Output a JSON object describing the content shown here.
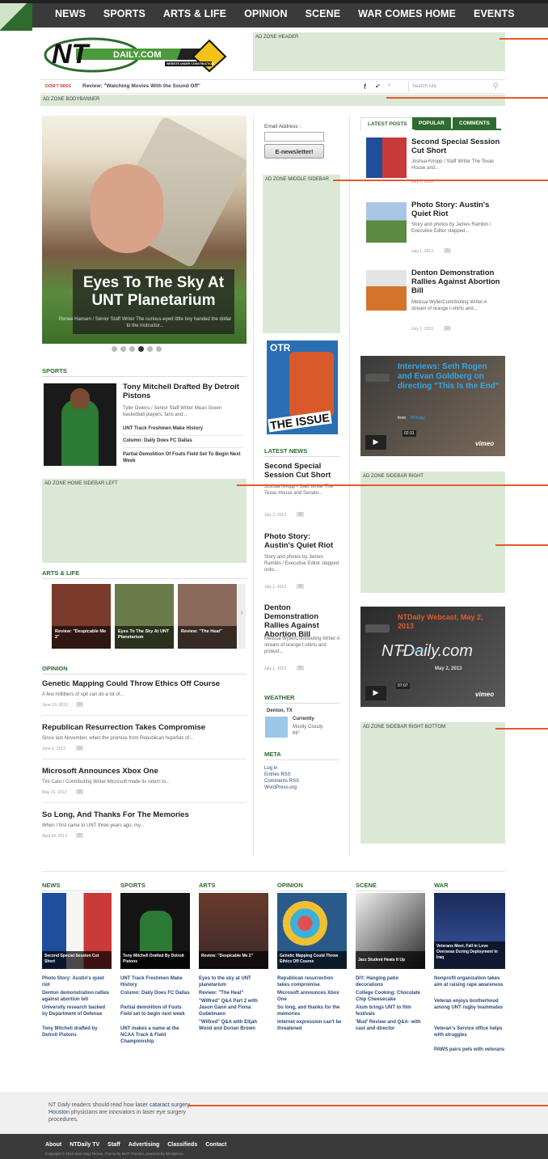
{
  "nav": {
    "items": [
      "NEWS",
      "SPORTS",
      "ARTS & LIFE",
      "OPINION",
      "SCENE",
      "WAR COMES HOME",
      "EVENTS"
    ]
  },
  "logo": {
    "text": "NT",
    "domain": "DAILY.COM",
    "tagline": "WEBSITE UNDER CONSTRUCTION"
  },
  "ads": {
    "header": "AD ZONE HEADER",
    "bodybanner": "AD ZONE BODYBANNER",
    "middle": "AD ZONE MIDDLE SIDEBAR",
    "home_left": "AD ZONE HOME SIDEBAR LEFT",
    "right": "AD ZONE SIDEBAR RIGHT",
    "right_bottom": "AD ZONE SIDEBAR RIGHT BOTTOM"
  },
  "ticker": {
    "label": "DON'T MISS",
    "text": "Review: \"Watching Movies With the Sound Off\"",
    "search_placeholder": "Search site"
  },
  "hero": {
    "title": "Eyes To The Sky At UNT Planetarium",
    "caption": "Renee Hansen / Senior Staff Writer The curious-eyed little boy handed the dollar to the instructor..."
  },
  "sports": {
    "heading": "SPORTS",
    "title": "Tony Mitchell Drafted By Detroit Pistons",
    "excerpt": "Tyler Owens / Senior Staff Writer Mean Green basketball players, fans and...",
    "links": [
      "UNT Track Freshmen Make History",
      "Column: Daily Does FC Dallas",
      "Partial Demolition Of Fouts Field Set To Begin Next Week"
    ]
  },
  "arts": {
    "heading": "ARTS & LIFE",
    "items": [
      "Review: \"Despicable Me 2\"",
      "Eyes To The Sky At UNT Planetarium",
      "Review: \"The Heat\""
    ]
  },
  "opinion": {
    "heading": "OPINION",
    "items": [
      {
        "title": "Genetic Mapping Could Throw Ethics Off Course",
        "excerpt": "A few milliliters of spit can do a lot of...",
        "date": "June 19, 2013",
        "count": "0"
      },
      {
        "title": "Republican Resurrection Takes Compromise",
        "excerpt": "Since last November, when the promise from Republican hopefuls of...",
        "date": "June 6, 2013",
        "count": "0"
      },
      {
        "title": "Microsoft Announces Xbox One",
        "excerpt": "Tim Cato / Contributing Writer Microsoft made its return to...",
        "date": "May 21, 2013",
        "count": "0"
      },
      {
        "title": "So Long, And Thanks For The Memories",
        "excerpt": "When I first came to UNT three years ago, my...",
        "date": "April 24, 2013",
        "count": "0"
      }
    ]
  },
  "middle": {
    "email_label": "Email Address :",
    "enews_button": "E-newsletter!",
    "otr": "OTR",
    "issue": "THE ISSUE",
    "latest_heading": "LATEST NEWS",
    "latest": [
      {
        "title": "Second Special Session Cut Short",
        "excerpt": "Joshua Knopp / Staff Writer The Texas House and Senate...",
        "date": "July 2, 2013",
        "count": "0"
      },
      {
        "title": "Photo Story: Austin's Quiet Riot",
        "excerpt": "Story and photos by James Rambin / Executive Editor stepped onto...",
        "date": "July 1, 2013",
        "count": "0"
      },
      {
        "title": "Denton Demonstration Rallies Against Abortion Bill",
        "excerpt": "Melissa Wylie/Contributing Writer A stream of orange t-shirts and protest...",
        "date": "July 1, 2013",
        "count": "0"
      }
    ],
    "weather_heading": "WEATHER",
    "weather_city": "Denton, TX",
    "weather_cond": "Currently",
    "weather_desc": "Mostly Cloudy",
    "weather_temp": "66°",
    "meta_heading": "META",
    "meta_links": [
      "Log in",
      "Entries RSS",
      "Comments RSS",
      "WordPress.org"
    ]
  },
  "tabs": {
    "items": [
      "LATEST POSTS",
      "POPULAR",
      "COMMENTS"
    ]
  },
  "right_posts": [
    {
      "title": "Second Special Session Cut Short",
      "excerpt": "Joshua Knopp / Staff Writer The Texas House and...",
      "date": "July 2, 2013",
      "count": "0"
    },
    {
      "title": "Photo Story: Austin's Quiet Riot",
      "excerpt": "Story and photos by James Rambin / Executive Editor stepped...",
      "date": "July 1, 2013",
      "count": "0"
    },
    {
      "title": "Denton Demonstration Rallies Against Abortion Bill",
      "excerpt": "Melissa Wylie/Contributing Writer A stream of orange t-shirts and...",
      "date": "July 1, 2013",
      "count": "0"
    }
  ],
  "videos": [
    {
      "title": "Interviews: Seth Rogen and Evan Goldberg on directing \"This Is the End\"",
      "from": "from",
      "source": "NTDaily",
      "time": "02:31",
      "brand": "vimeo"
    },
    {
      "title": "NTDaily Webcast, May 2, 2013",
      "from": "from",
      "source": "NTDaily",
      "time": "07:07",
      "brand": "vimeo",
      "wordmark": "NTDaily.com",
      "date_overlay": "May 2, 2013"
    }
  ],
  "bottom_sections": [
    {
      "heading": "NEWS",
      "caption": "Second Special Session Cut Short",
      "links": [
        "Photo Story: Austin's quiet riot",
        "Denton demonstration rallies against abortion bill",
        "University research backed by Department of Defense",
        "Tony Mitchell drafted by Detroit Pistons"
      ]
    },
    {
      "heading": "SPORTS",
      "caption": "Tony Mitchell Drafted By Detroit Pistons",
      "links": [
        "UNT Track Freshmen Make History",
        "Column: Daily Does FC Dallas",
        "Partial demolition of Fouts Field set to begin next week",
        "UNT makes a name at the NCAA Track & Field Championship"
      ]
    },
    {
      "heading": "ARTS",
      "caption": "Review: \"Despicable Me 2\"",
      "links": [
        "Eyes to the sky at UNT planetarium",
        "Review: \"The Heat\"",
        "\"Wilfred\" Q&A Part 2 with Jason Gann and Fiona Gubelmann",
        "\"Wilfred\" Q&A with Elijah Wood and Dorian Brown"
      ]
    },
    {
      "heading": "OPINION",
      "caption": "Genetic Mapping Could Throw Ethics Off Course",
      "links": [
        "Republican resurrection takes compromise",
        "Microsoft announces Xbox One",
        "So long, and thanks for the memories",
        "Internet expression can't be threatened"
      ]
    },
    {
      "heading": "SCENE",
      "caption": "Jazz Student Heats It Up",
      "links": [
        "DIY: Hanging patio decorations",
        "College Cooking: Chocolate Chip Cheesecake",
        "Alum brings UNT to film festivals",
        "'Mud' Review and Q&A- with cast and director"
      ]
    },
    {
      "heading": "WAR",
      "caption": "Veterans Meet, Fall In Love Overseas During Deployment In Iraq",
      "links": [
        "Nonprofit organization takes aim at raising rape awareness",
        "Veteran enjoys brotherhood among UNT rugby teammates",
        "Veteran's Service office helps with struggles",
        "PAWS pairs pets with veterans"
      ]
    }
  ],
  "promo": {
    "pre": "NT Daily readers should read how ",
    "link": "laser cataract surgery Houston",
    "post": " physicians are innovators in laser eye surgery procedures."
  },
  "footer": {
    "links": [
      "About",
      "NTDaily TV",
      "Staff",
      "Advertising",
      "Classifieds",
      "Contact"
    ],
    "copyright": "Copyright © 2013 Mais Mag Theme. Theme by MVP Themes, powered by Wordpress."
  },
  "colors": {
    "brand_green": "#2e6b2e",
    "nav_bg": "#3a3a3a",
    "ad_bg": "#dbe8d5",
    "annotation": "#e25a2b"
  }
}
